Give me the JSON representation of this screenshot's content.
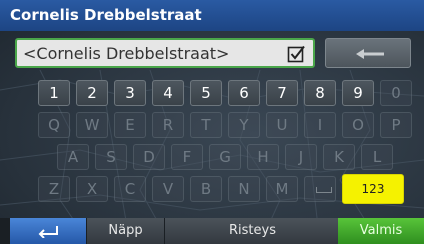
{
  "header": {
    "title": "Cornelis Drebbelstraat"
  },
  "input": {
    "value": "<Cornelis Drebbelstraat>"
  },
  "keyboard": {
    "numbers": [
      "1",
      "2",
      "3",
      "4",
      "5",
      "6",
      "7",
      "8",
      "9",
      "0"
    ],
    "row1": [
      "Q",
      "W",
      "E",
      "R",
      "T",
      "Y",
      "U",
      "I",
      "O",
      "P"
    ],
    "row2": [
      "A",
      "S",
      "D",
      "F",
      "G",
      "H",
      "J",
      "K",
      "L"
    ],
    "row3": [
      "Z",
      "X",
      "C",
      "V",
      "B",
      "N",
      "M"
    ],
    "mode_label": "123"
  },
  "bottom_bar": {
    "napp_label": "Näpp",
    "risteys_label": "Risteys",
    "valmis_label": "Valmis"
  },
  "colors": {
    "title_bar": "#1d4584",
    "input_border": "#4aa64a",
    "mode_key": "#f5f200",
    "valmis": "#3ea52a",
    "back_button": "#3a72c4"
  }
}
